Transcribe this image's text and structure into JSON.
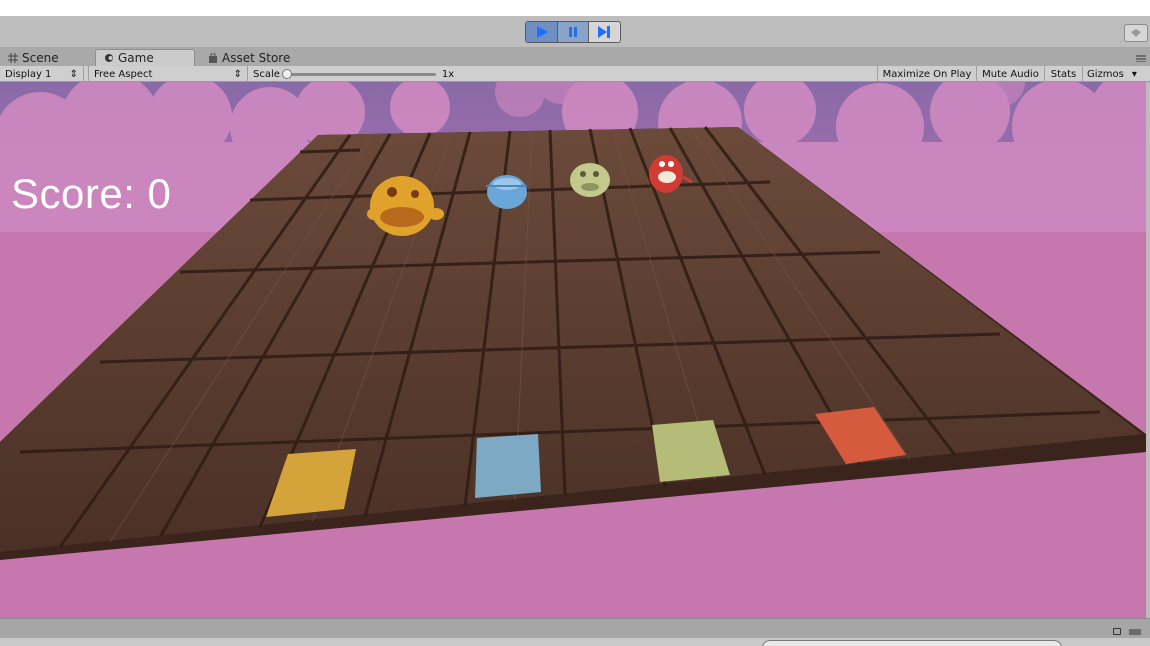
{
  "toolbar": {
    "play_icon": "play-icon",
    "pause_icon": "pause-icon",
    "step_icon": "step-icon",
    "cloud_icon": "cloud-icon",
    "play_active_color": "#1f6fff"
  },
  "tabs": [
    {
      "label": "Scene",
      "icon": "grid-icon"
    },
    {
      "label": "Game",
      "icon": "game-controller-icon",
      "active": true
    },
    {
      "label": "Asset Store",
      "icon": "store-bag-icon"
    }
  ],
  "game_bar": {
    "display": "Display 1",
    "aspect": "Free Aspect",
    "scale_label": "Scale",
    "scale_value": "1x",
    "maximize_on_play": "Maximize On Play",
    "mute_audio": "Mute Audio",
    "stats": "Stats",
    "gizmos": "Gizmos"
  },
  "game": {
    "score_text": "Score: 0",
    "sky_color": "#c677ad",
    "cloud_color": "#d98ac2",
    "floor_color": "#5a3b2e",
    "characters": [
      {
        "name": "yellow-monster",
        "color": "#e0a22a"
      },
      {
        "name": "blue-monster",
        "color": "#6aa6d8"
      },
      {
        "name": "green-monster",
        "color": "#c3c98a"
      },
      {
        "name": "red-monster",
        "color": "#d23b34"
      }
    ],
    "pads": [
      {
        "name": "yellow-pad",
        "color": "#d4a43a"
      },
      {
        "name": "blue-pad",
        "color": "#7ea9c4"
      },
      {
        "name": "green-pad",
        "color": "#b4bc78"
      },
      {
        "name": "orange-pad",
        "color": "#d55a3e"
      }
    ]
  }
}
